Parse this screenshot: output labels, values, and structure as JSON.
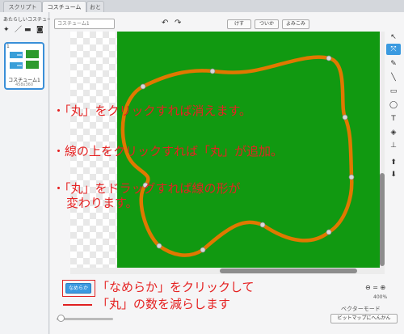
{
  "tabs": [
    {
      "label": "スクリプト",
      "active": false
    },
    {
      "label": "コスチューム",
      "active": true
    },
    {
      "label": "おと",
      "active": false
    }
  ],
  "left_panel": {
    "new_costume_label": "あたらしいコスチューム",
    "new_costume_icons": [
      "paint-brush-icon",
      "pencil-icon",
      "folder-upload-icon",
      "camera-icon"
    ],
    "costume": {
      "number": "1",
      "name": "コスチューム1",
      "size": "458x360"
    }
  },
  "editor": {
    "name_placeholder": "コスチューム1",
    "undo_icon": "undo-icon",
    "redo_icon": "redo-icon",
    "buttons": {
      "clear": "けす",
      "add": "ついか",
      "import": "よみこみ"
    },
    "zoom_icons": [
      "zoom-out-icon",
      "zoom-reset-icon",
      "zoom-in-icon"
    ],
    "zoom_level": "400%",
    "mode_label": "ベクターモード",
    "convert_button": "ビットマップにへんかん",
    "smooth_button": "なめらか"
  },
  "tools": [
    {
      "name": "select-arrow-icon",
      "glyph": "↖",
      "selected": false
    },
    {
      "name": "reshape-icon",
      "glyph": "⤧",
      "selected": true
    },
    {
      "name": "pencil-icon",
      "glyph": "✎",
      "selected": false
    },
    {
      "name": "line-icon",
      "glyph": "╲",
      "selected": false
    },
    {
      "name": "rectangle-icon",
      "glyph": "▭",
      "selected": false
    },
    {
      "name": "ellipse-icon",
      "glyph": "◯",
      "selected": false
    },
    {
      "name": "text-icon",
      "glyph": "T",
      "selected": false
    },
    {
      "name": "fill-bucket-icon",
      "glyph": "◈",
      "selected": false
    },
    {
      "name": "stamp-icon",
      "glyph": "⊥",
      "selected": false
    },
    {
      "name": "forward-layer-icon",
      "glyph": "⬆",
      "selected": false
    },
    {
      "name": "backward-layer-icon",
      "glyph": "⬇",
      "selected": false
    }
  ],
  "annotations": {
    "line1": "・「丸」をクリックすれば消えます。",
    "line2": "・線の上をクリックすれば「丸」が追加。",
    "line3a": "・「丸」をドラッグすれば線の形が",
    "line3b": "変わります。",
    "bottom1": "「なめらか」をクリックして",
    "bottom2": "「丸」の数を減らします"
  },
  "colors": {
    "canvas_fill": "#119911",
    "shape_stroke": "#e07800",
    "annotation_red": "#e52222",
    "selected_tool": "#3b9ae0"
  }
}
